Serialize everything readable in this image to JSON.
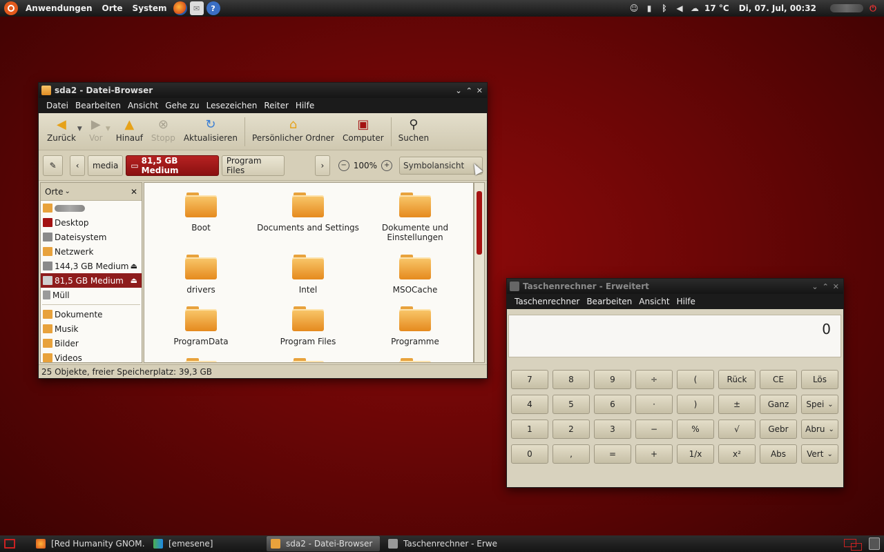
{
  "top_panel": {
    "menus": [
      "Anwendungen",
      "Orte",
      "System"
    ],
    "launchers": [
      "firefox-icon",
      "mail-icon",
      "help-icon"
    ],
    "tray": [
      "user-status-icon",
      "network-signal-icon",
      "bluetooth-icon",
      "volume-icon",
      "weather-icon"
    ],
    "weather": "17 °C",
    "clock": "Di, 07. Jul, 00:32"
  },
  "file_browser": {
    "title": "sda2 - Datei-Browser",
    "menu": [
      "Datei",
      "Bearbeiten",
      "Ansicht",
      "Gehe zu",
      "Lesezeichen",
      "Reiter",
      "Hilfe"
    ],
    "toolbar": {
      "back": "Zurück",
      "forward": "Vor",
      "up": "Hinauf",
      "stop": "Stopp",
      "reload": "Aktualisieren",
      "home": "Persönlicher Ordner",
      "computer": "Computer",
      "search": "Suchen"
    },
    "path": [
      "media",
      "81,5 GB Medium",
      "Program Files"
    ],
    "zoom": "100%",
    "view_mode": "Symbolansicht",
    "sidebar": {
      "title": "Orte",
      "items": [
        {
          "label": "Desktop"
        },
        {
          "label": "Dateisystem"
        },
        {
          "label": "Netzwerk"
        },
        {
          "label": "144,3 GB Medium"
        },
        {
          "label": "81,5 GB Medium"
        },
        {
          "label": "Müll"
        }
      ],
      "bookmarks": [
        {
          "label": "Dokumente"
        },
        {
          "label": "Musik"
        },
        {
          "label": "Bilder"
        },
        {
          "label": "Videos"
        }
      ]
    },
    "files": [
      {
        "name": "Boot"
      },
      {
        "name": "Documents and Settings"
      },
      {
        "name": "Dokumente und Einstellungen"
      },
      {
        "name": "drivers"
      },
      {
        "name": "Intel"
      },
      {
        "name": "MSOCache"
      },
      {
        "name": "ProgramData"
      },
      {
        "name": "Program Files"
      },
      {
        "name": "Programme"
      }
    ],
    "status": "25 Objekte, freier Speicherplatz: 39,3 GB"
  },
  "calculator": {
    "title": "Taschenrechner - Erweitert",
    "menu": [
      "Taschenrechner",
      "Bearbeiten",
      "Ansicht",
      "Hilfe"
    ],
    "display": "0",
    "keys": [
      [
        "7",
        "8",
        "9",
        "÷",
        "(",
        "Rück",
        "CE",
        "Lös"
      ],
      [
        "4",
        "5",
        "6",
        "·",
        ")",
        "±",
        "Ganz",
        "Spei"
      ],
      [
        "1",
        "2",
        "3",
        "−",
        "%",
        "√",
        "Gebr",
        "Abru"
      ],
      [
        "0",
        ",",
        "=",
        "+",
        "1/x",
        "x²",
        "Abs",
        "Vert"
      ]
    ]
  },
  "taskbar": {
    "tasks": [
      {
        "label": "[Red Humanity GNOM…"
      },
      {
        "label": "[emesene]"
      },
      {
        "label": "sda2 - Datei-Browser"
      },
      {
        "label": "Taschenrechner - Erwe…"
      }
    ]
  }
}
